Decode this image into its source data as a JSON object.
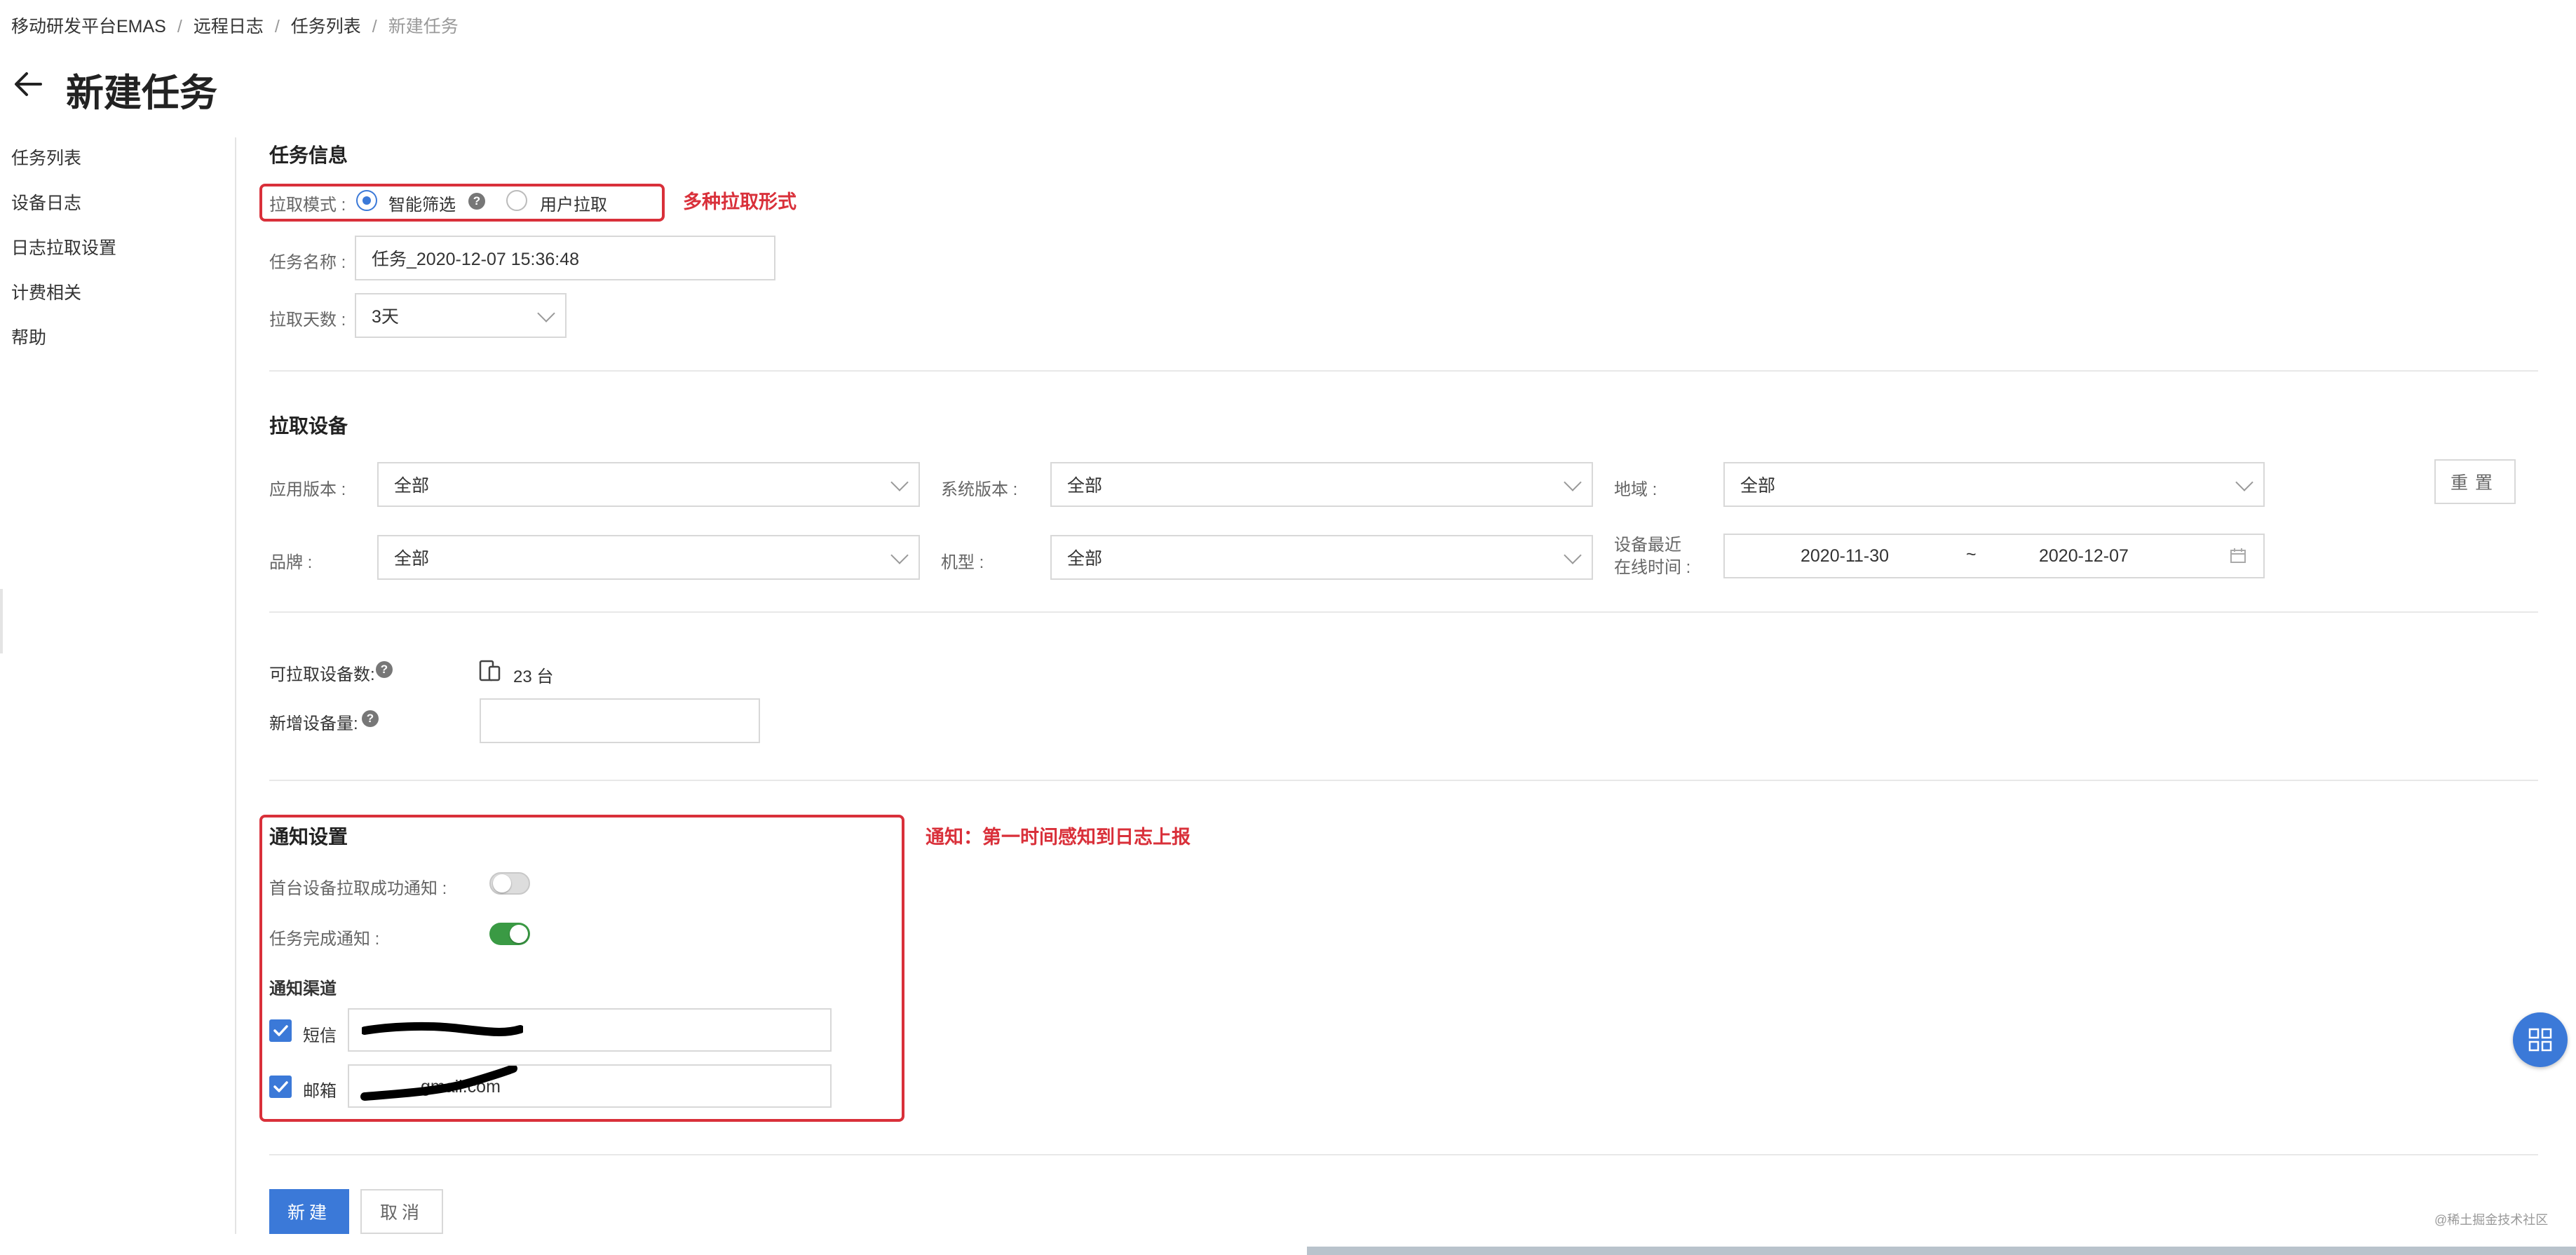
{
  "breadcrumb": {
    "item1": "移动研发平台EMAS",
    "item2": "远程日志",
    "item3": "任务列表",
    "item4": "新建任务",
    "separator": "/"
  },
  "page": {
    "title": "新建任务"
  },
  "sidebar": {
    "items": [
      {
        "label": "任务列表"
      },
      {
        "label": "设备日志"
      },
      {
        "label": "日志拉取设置"
      },
      {
        "label": "计费相关"
      },
      {
        "label": "帮助"
      }
    ]
  },
  "task_info": {
    "title": "任务信息",
    "pull_mode_label": "拉取模式 :",
    "pull_mode_options": [
      {
        "label": "智能筛选",
        "selected": true
      },
      {
        "label": "用户拉取",
        "selected": false
      }
    ],
    "help_glyph": "?",
    "task_name_label": "任务名称 :",
    "task_name_value": "任务_2020-12-07 15:36:48",
    "days_label": "拉取天数 :",
    "days_value": "3天"
  },
  "annotations": {
    "pull_mode": "多种拉取形式",
    "notify": "通知：第一时间感知到日志上报"
  },
  "device_filter": {
    "title": "拉取设备",
    "app_version_label": "应用版本 :",
    "app_version_value": "全部",
    "os_version_label": "系统版本 :",
    "os_version_value": "全部",
    "region_label": "地域 :",
    "region_value": "全部",
    "reset_label": "重置",
    "brand_label": "品牌 :",
    "brand_value": "全部",
    "model_label": "机型 :",
    "model_value": "全部",
    "online_time_label_line1": "设备最近",
    "online_time_label_line2": "在线时间 :",
    "date_start": "2020-11-30",
    "date_tilde": "~",
    "date_end": "2020-12-07"
  },
  "device_count": {
    "available_label": "可拉取设备数:",
    "available_value": "23 台",
    "new_label": "新增设备量:",
    "new_value": ""
  },
  "notify": {
    "title": "通知设置",
    "first_device_label": "首台设备拉取成功通知 :",
    "first_device_on": false,
    "task_done_label": "任务完成通知 :",
    "task_done_on": true,
    "channel_title": "通知渠道",
    "sms_label": "短信",
    "sms_checked": true,
    "email_label": "邮箱",
    "email_checked": true,
    "email_value_visible": "gmail.com"
  },
  "actions": {
    "create_label": "新建",
    "cancel_label": "取消"
  },
  "watermark": "@稀土掘金技术社区",
  "colors": {
    "primary": "#3b79d8",
    "annotation_red": "#d9303a",
    "toggle_on": "#3a9a44"
  }
}
